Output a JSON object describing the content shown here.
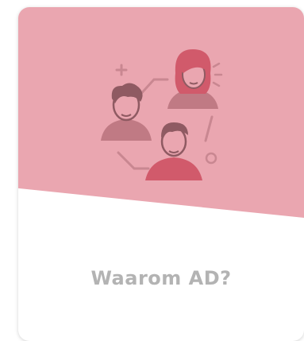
{
  "card": {
    "title": "Waarom AD?",
    "accent_color": "#eaa6b0",
    "icons": [
      "team-illustration-icon"
    ]
  }
}
